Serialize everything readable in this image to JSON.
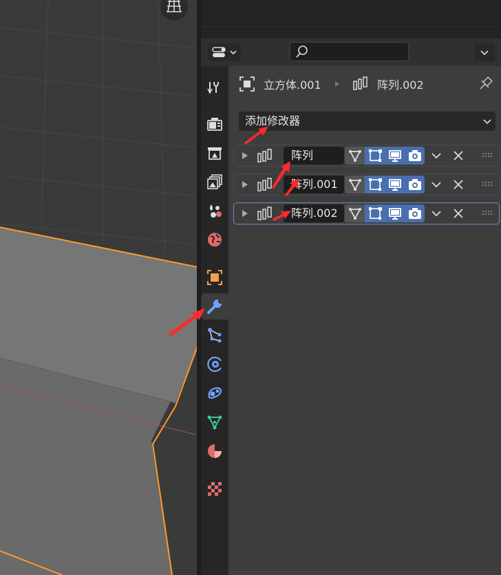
{
  "breadcrumb": {
    "object_name": "立方体.001",
    "modifier_name": "阵列.002"
  },
  "add_modifier": {
    "label": "添加修改器"
  },
  "search": {
    "placeholder": ""
  },
  "modifiers": [
    {
      "name": "阵列",
      "selected": false
    },
    {
      "name": "阵列.001",
      "selected": false
    },
    {
      "name": "阵列.002",
      "selected": true
    }
  ],
  "tabs": [
    {
      "name": "tool-tab",
      "icon": "tool-icon"
    },
    {
      "name": "render-tab",
      "icon": "render-icon"
    },
    {
      "name": "output-tab",
      "icon": "output-icon"
    },
    {
      "name": "view-layer-tab",
      "icon": "view-layer-icon"
    },
    {
      "name": "scene-tab",
      "icon": "scene-icon"
    },
    {
      "name": "world-tab",
      "icon": "world-icon"
    },
    {
      "name": "object-tab",
      "icon": "object-icon"
    },
    {
      "name": "modifier-tab",
      "icon": "wrench-icon",
      "active": true
    },
    {
      "name": "particles-tab",
      "icon": "particles-icon"
    },
    {
      "name": "physics-tab",
      "icon": "physics-icon"
    },
    {
      "name": "constraints-tab",
      "icon": "constraint-icon"
    },
    {
      "name": "data-tab",
      "icon": "mesh-data-icon"
    },
    {
      "name": "material-tab",
      "icon": "material-icon"
    },
    {
      "name": "texture-tab",
      "icon": "texture-icon"
    }
  ],
  "colors": {
    "accent_blue": "#4a6fae",
    "selection_orange": "#ff9a2a",
    "annotation_red": "#ff2a2a"
  }
}
